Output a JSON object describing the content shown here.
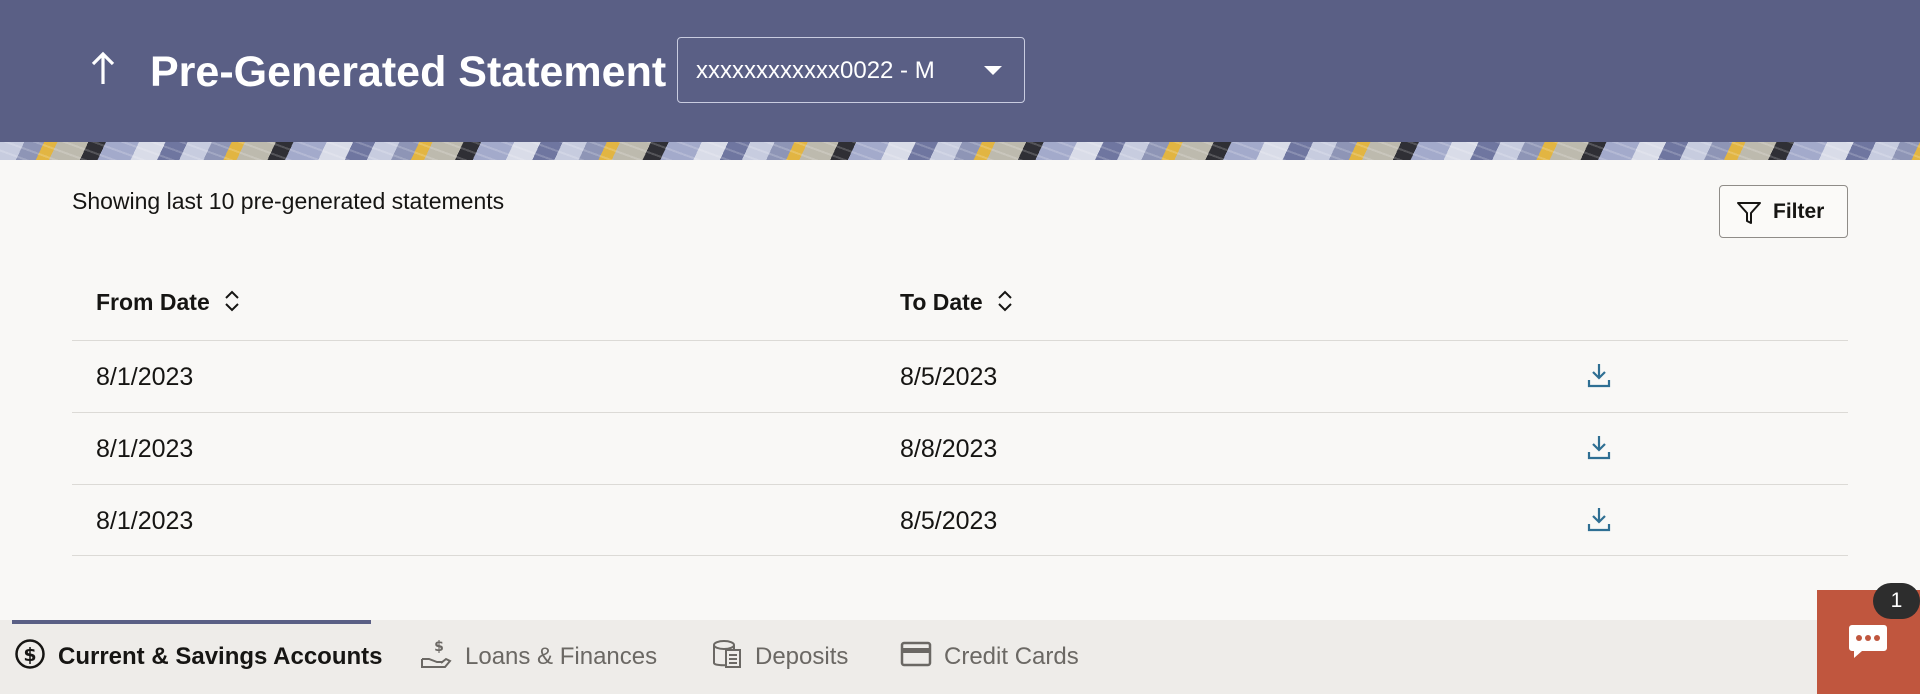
{
  "header": {
    "title": "Pre-Generated Statement",
    "back_icon": "arrow-up-icon",
    "account_selector": {
      "value": "xxxxxxxxxxxx0022 - M"
    },
    "background_color": "#5a5f85"
  },
  "content": {
    "showing_text": "Showing last 10 pre-generated statements",
    "filter_label": "Filter"
  },
  "table": {
    "columns": [
      "From Date",
      "To Date"
    ],
    "rows": [
      {
        "from": "8/1/2023",
        "to": "8/5/2023",
        "action_icon": "download-icon"
      },
      {
        "from": "8/1/2023",
        "to": "8/8/2023",
        "action_icon": "download-icon"
      },
      {
        "from": "8/1/2023",
        "to": "8/5/2023",
        "action_icon": "download-icon"
      }
    ]
  },
  "bottom_tabs": [
    {
      "label": "Current & Savings Accounts",
      "icon": "dollar-circle-icon",
      "active": true
    },
    {
      "label": "Loans & Finances",
      "icon": "hand-money-icon",
      "active": false
    },
    {
      "label": "Deposits",
      "icon": "coin-stack-icon",
      "active": false
    },
    {
      "label": "Credit Cards",
      "icon": "credit-card-icon",
      "active": false
    }
  ],
  "chat": {
    "badge_count": "1",
    "icon": "chat-bubble-icon",
    "color": "#c0563e"
  }
}
